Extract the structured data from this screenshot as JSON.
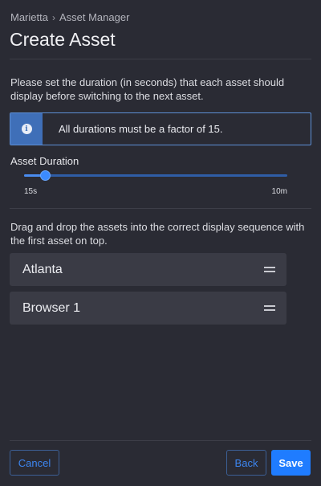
{
  "breadcrumb": {
    "items": [
      "Marietta",
      "Asset Manager"
    ],
    "separator": "›"
  },
  "page_title": "Create Asset",
  "duration_description": "Please set the duration (in seconds) that each asset should display before switching to the next asset.",
  "info_notice": {
    "icon": "info-icon",
    "icon_glyph": "i",
    "text": "All durations must be a factor of 15."
  },
  "asset_duration": {
    "label": "Asset Duration",
    "min_label": "15s",
    "max_label": "10m",
    "value_fraction": 0.08
  },
  "sequence_description": "Drag and drop the assets into the correct display sequence with the first asset on top.",
  "assets": [
    {
      "name": "Atlanta",
      "handle_icon": "drag-handle-icon"
    },
    {
      "name": "Browser 1",
      "handle_icon": "drag-handle-icon"
    }
  ],
  "footer": {
    "cancel_label": "Cancel",
    "back_label": "Back",
    "save_label": "Save"
  },
  "colors": {
    "background": "#2a2b34",
    "accent": "#1f7cff",
    "info_border": "#5d8fd6",
    "card": "#3a3b45"
  }
}
